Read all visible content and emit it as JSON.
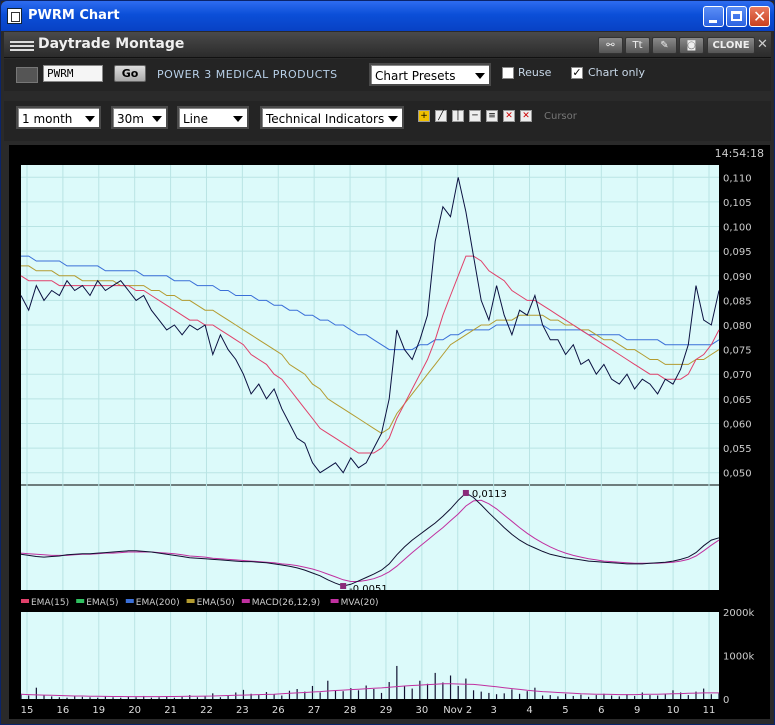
{
  "window": {
    "title": "PWRM Chart"
  },
  "montage": {
    "title": "Daytrade Montage",
    "clone_label": "CLONE",
    "icons": [
      "link-icon",
      "text-size-icon",
      "paint-icon",
      "camera-icon"
    ],
    "text_icon_glyph": "Tt"
  },
  "toolbar": {
    "symbol_value": "PWRM",
    "go_label": "Go",
    "company_name": "POWER 3 MEDICAL PRODUCTS",
    "chart_presets_label": "Chart Presets",
    "reuse_label": "Reuse",
    "reuse_checked": false,
    "chart_only_label": "Chart only",
    "chart_only_checked": true,
    "period_value": "1 month",
    "interval_value": "30m",
    "chart_type_value": "Line",
    "indicators_label": "Technical Indicators",
    "cursor_label": "Cursor"
  },
  "chart": {
    "time_readout": "14:54:18",
    "colors": {
      "background": "#dcfafa",
      "price": "#0a1040",
      "ema15": "#e0406a",
      "ema200": "#3a6fd8",
      "ema50": "#b39b30",
      "macd": "#101030",
      "mva": "#c030a0",
      "volume": "#101030",
      "volume_avg": "#c030a0"
    }
  },
  "chart_data": {
    "type": "line",
    "price_axis": {
      "ticks": [
        "0,050",
        "0,055",
        "0,060",
        "0,065",
        "0,070",
        "0,075",
        "0,080",
        "0,085",
        "0,090",
        "0,095",
        "0,100",
        "0,105",
        "0,110"
      ],
      "ylim": [
        0.0475,
        0.1125
      ]
    },
    "volume_axis": {
      "ticks": [
        "0",
        "1000k",
        "2000k"
      ]
    },
    "x_tick_labels": [
      "15",
      "16",
      "19",
      "20",
      "21",
      "22",
      "23",
      "26",
      "27",
      "28",
      "29",
      "30",
      "Nov 2",
      "3",
      "4",
      "5",
      "6",
      "9",
      "10",
      "11"
    ],
    "legend": [
      {
        "name": "EMA(15)",
        "color": "#e0406a"
      },
      {
        "name": "EMA(5)",
        "color": "#30c060"
      },
      {
        "name": "EMA(200)",
        "color": "#3a6fd8"
      },
      {
        "name": "EMA(50)",
        "color": "#b39b30"
      },
      {
        "name": "MACD(26,12,9)",
        "color": "#c030a0"
      },
      {
        "name": "MVA(20)",
        "color": "#c030a0"
      }
    ],
    "macd_annotations": {
      "max_label": "0,0113",
      "min_label": "-0,0051"
    },
    "price": [
      0.086,
      0.083,
      0.088,
      0.085,
      0.087,
      0.086,
      0.089,
      0.087,
      0.088,
      0.086,
      0.089,
      0.087,
      0.088,
      0.089,
      0.087,
      0.085,
      0.086,
      0.083,
      0.081,
      0.079,
      0.08,
      0.078,
      0.08,
      0.079,
      0.08,
      0.074,
      0.078,
      0.075,
      0.073,
      0.07,
      0.066,
      0.068,
      0.065,
      0.067,
      0.063,
      0.06,
      0.057,
      0.056,
      0.052,
      0.05,
      0.051,
      0.052,
      0.05,
      0.053,
      0.051,
      0.052,
      0.055,
      0.058,
      0.065,
      0.079,
      0.075,
      0.073,
      0.077,
      0.082,
      0.097,
      0.104,
      0.102,
      0.11,
      0.103,
      0.094,
      0.085,
      0.081,
      0.088,
      0.082,
      0.078,
      0.083,
      0.082,
      0.086,
      0.08,
      0.077,
      0.077,
      0.074,
      0.076,
      0.072,
      0.073,
      0.07,
      0.072,
      0.069,
      0.068,
      0.07,
      0.067,
      0.069,
      0.068,
      0.066,
      0.069,
      0.068,
      0.071,
      0.076,
      0.088,
      0.081,
      0.08,
      0.087
    ],
    "ema15": [
      0.09,
      0.089,
      0.089,
      0.089,
      0.089,
      0.088,
      0.088,
      0.088,
      0.088,
      0.088,
      0.088,
      0.088,
      0.088,
      0.088,
      0.088,
      0.087,
      0.087,
      0.086,
      0.085,
      0.084,
      0.083,
      0.082,
      0.081,
      0.081,
      0.08,
      0.08,
      0.079,
      0.078,
      0.077,
      0.076,
      0.074,
      0.073,
      0.072,
      0.07,
      0.069,
      0.067,
      0.065,
      0.063,
      0.061,
      0.059,
      0.058,
      0.057,
      0.056,
      0.055,
      0.054,
      0.054,
      0.054,
      0.055,
      0.057,
      0.061,
      0.064,
      0.067,
      0.07,
      0.073,
      0.077,
      0.082,
      0.086,
      0.09,
      0.094,
      0.094,
      0.093,
      0.091,
      0.09,
      0.089,
      0.087,
      0.086,
      0.085,
      0.085,
      0.084,
      0.083,
      0.082,
      0.081,
      0.08,
      0.079,
      0.078,
      0.077,
      0.076,
      0.075,
      0.074,
      0.073,
      0.072,
      0.071,
      0.07,
      0.07,
      0.069,
      0.069,
      0.069,
      0.07,
      0.073,
      0.074,
      0.076,
      0.079
    ],
    "ema50": [
      0.092,
      0.092,
      0.091,
      0.091,
      0.091,
      0.09,
      0.09,
      0.09,
      0.089,
      0.089,
      0.089,
      0.089,
      0.089,
      0.088,
      0.088,
      0.088,
      0.088,
      0.087,
      0.087,
      0.086,
      0.086,
      0.085,
      0.085,
      0.084,
      0.083,
      0.083,
      0.082,
      0.081,
      0.08,
      0.079,
      0.078,
      0.077,
      0.076,
      0.075,
      0.074,
      0.072,
      0.071,
      0.07,
      0.068,
      0.067,
      0.065,
      0.064,
      0.063,
      0.062,
      0.061,
      0.06,
      0.059,
      0.058,
      0.059,
      0.062,
      0.064,
      0.066,
      0.068,
      0.07,
      0.072,
      0.074,
      0.076,
      0.077,
      0.078,
      0.079,
      0.08,
      0.08,
      0.081,
      0.081,
      0.081,
      0.082,
      0.082,
      0.082,
      0.082,
      0.081,
      0.081,
      0.08,
      0.08,
      0.079,
      0.079,
      0.078,
      0.077,
      0.077,
      0.076,
      0.075,
      0.075,
      0.074,
      0.073,
      0.073,
      0.072,
      0.072,
      0.072,
      0.072,
      0.073,
      0.073,
      0.074,
      0.075
    ],
    "ema200": [
      0.094,
      0.094,
      0.093,
      0.093,
      0.093,
      0.093,
      0.092,
      0.092,
      0.092,
      0.092,
      0.092,
      0.091,
      0.091,
      0.091,
      0.091,
      0.091,
      0.09,
      0.09,
      0.09,
      0.09,
      0.089,
      0.089,
      0.089,
      0.088,
      0.088,
      0.088,
      0.087,
      0.087,
      0.086,
      0.086,
      0.086,
      0.085,
      0.085,
      0.084,
      0.084,
      0.083,
      0.083,
      0.082,
      0.082,
      0.081,
      0.081,
      0.08,
      0.08,
      0.079,
      0.078,
      0.078,
      0.077,
      0.076,
      0.075,
      0.075,
      0.075,
      0.075,
      0.076,
      0.076,
      0.077,
      0.077,
      0.078,
      0.078,
      0.079,
      0.079,
      0.079,
      0.079,
      0.08,
      0.08,
      0.08,
      0.08,
      0.08,
      0.08,
      0.08,
      0.079,
      0.079,
      0.079,
      0.079,
      0.079,
      0.078,
      0.078,
      0.078,
      0.078,
      0.078,
      0.077,
      0.077,
      0.077,
      0.077,
      0.077,
      0.076,
      0.076,
      0.076,
      0.076,
      0.076,
      0.076,
      0.076,
      0.077
    ],
    "macd": [
      0.0005,
      0.0003,
      0.0001,
      0.0,
      0.0001,
      0.0002,
      0.0004,
      0.0005,
      0.0006,
      0.0006,
      0.0007,
      0.0008,
      0.0009,
      0.001,
      0.0011,
      0.0011,
      0.001,
      0.0009,
      0.0007,
      0.0005,
      0.0003,
      0.0001,
      -0.0001,
      -0.0002,
      -0.0003,
      -0.0004,
      -0.0005,
      -0.0006,
      -0.0007,
      -0.0008,
      -0.0008,
      -0.0009,
      -0.001,
      -0.0012,
      -0.0014,
      -0.0016,
      -0.0019,
      -0.0023,
      -0.0028,
      -0.0033,
      -0.004,
      -0.0046,
      -0.0051,
      -0.0048,
      -0.0042,
      -0.0036,
      -0.003,
      -0.0023,
      -0.0012,
      0.0004,
      0.0018,
      0.003,
      0.004,
      0.005,
      0.006,
      0.0072,
      0.0085,
      0.01,
      0.0113,
      0.0105,
      0.0092,
      0.0078,
      0.0065,
      0.0052,
      0.004,
      0.003,
      0.0022,
      0.0016,
      0.001,
      0.0005,
      0.0002,
      -0.0001,
      -0.0003,
      -0.0005,
      -0.0007,
      -0.0008,
      -0.0009,
      -0.001,
      -0.0011,
      -0.0012,
      -0.0012,
      -0.0012,
      -0.0011,
      -0.001,
      -0.0009,
      -0.0007,
      -0.0004,
      0.0,
      0.0008,
      0.002,
      0.003,
      0.0034
    ],
    "mva": [
      0.0007,
      0.0006,
      0.0005,
      0.0004,
      0.0003,
      0.0003,
      0.0003,
      0.0004,
      0.0005,
      0.0005,
      0.0006,
      0.0007,
      0.0007,
      0.0008,
      0.0009,
      0.0009,
      0.0009,
      0.0009,
      0.0008,
      0.0007,
      0.0006,
      0.0004,
      0.0002,
      0.0001,
      0.0,
      -0.0002,
      -0.0003,
      -0.0004,
      -0.0005,
      -0.0006,
      -0.0007,
      -0.0008,
      -0.0009,
      -0.001,
      -0.0012,
      -0.0013,
      -0.0015,
      -0.0018,
      -0.0021,
      -0.0025,
      -0.003,
      -0.0035,
      -0.004,
      -0.0043,
      -0.0043,
      -0.0041,
      -0.0038,
      -0.0033,
      -0.0026,
      -0.0016,
      -0.0004,
      0.0008,
      0.0019,
      0.003,
      0.0041,
      0.0052,
      0.0064,
      0.0076,
      0.009,
      0.0099,
      0.01,
      0.0094,
      0.0085,
      0.0074,
      0.0063,
      0.0052,
      0.0042,
      0.0033,
      0.0025,
      0.0018,
      0.0012,
      0.0007,
      0.0003,
      0.0,
      -0.0003,
      -0.0005,
      -0.0007,
      -0.0008,
      -0.0009,
      -0.001,
      -0.0011,
      -0.0011,
      -0.0011,
      -0.0011,
      -0.001,
      -0.0009,
      -0.0007,
      -0.0004,
      0.0002,
      0.0011,
      0.0021,
      0.003
    ],
    "macd_ylim": [
      -0.0058,
      0.012
    ],
    "volume_k": [
      120,
      80,
      260,
      90,
      60,
      40,
      30,
      70,
      50,
      40,
      30,
      60,
      40,
      30,
      50,
      40,
      70,
      30,
      40,
      60,
      30,
      50,
      90,
      40,
      60,
      130,
      40,
      70,
      150,
      210,
      120,
      90,
      160,
      110,
      80,
      190,
      230,
      170,
      300,
      150,
      420,
      200,
      180,
      250,
      200,
      310,
      230,
      140,
      390,
      760,
      300,
      240,
      420,
      350,
      600,
      380,
      540,
      300,
      470,
      200,
      170,
      140,
      110,
      130,
      220,
      120,
      180,
      260,
      80,
      90,
      60,
      120,
      70,
      100,
      50,
      90,
      120,
      80,
      60,
      110,
      70,
      150,
      90,
      80,
      120,
      200,
      150,
      90,
      170,
      240,
      110,
      130
    ],
    "volume_avg_k": [
      110,
      100,
      95,
      90,
      88,
      80,
      75,
      70,
      68,
      65,
      62,
      60,
      58,
      57,
      56,
      55,
      55,
      55,
      56,
      57,
      58,
      60,
      62,
      64,
      66,
      70,
      75,
      80,
      85,
      90,
      95,
      100,
      105,
      110,
      120,
      130,
      140,
      150,
      160,
      170,
      185,
      195,
      205,
      215,
      225,
      235,
      245,
      255,
      270,
      285,
      300,
      310,
      320,
      330,
      340,
      350,
      350,
      345,
      340,
      335,
      320,
      300,
      280,
      260,
      240,
      220,
      200,
      185,
      170,
      160,
      150,
      140,
      130,
      120,
      115,
      110,
      108,
      105,
      100,
      100,
      100,
      105,
      108,
      110,
      115,
      120,
      125,
      130,
      135,
      140,
      140,
      140
    ]
  }
}
